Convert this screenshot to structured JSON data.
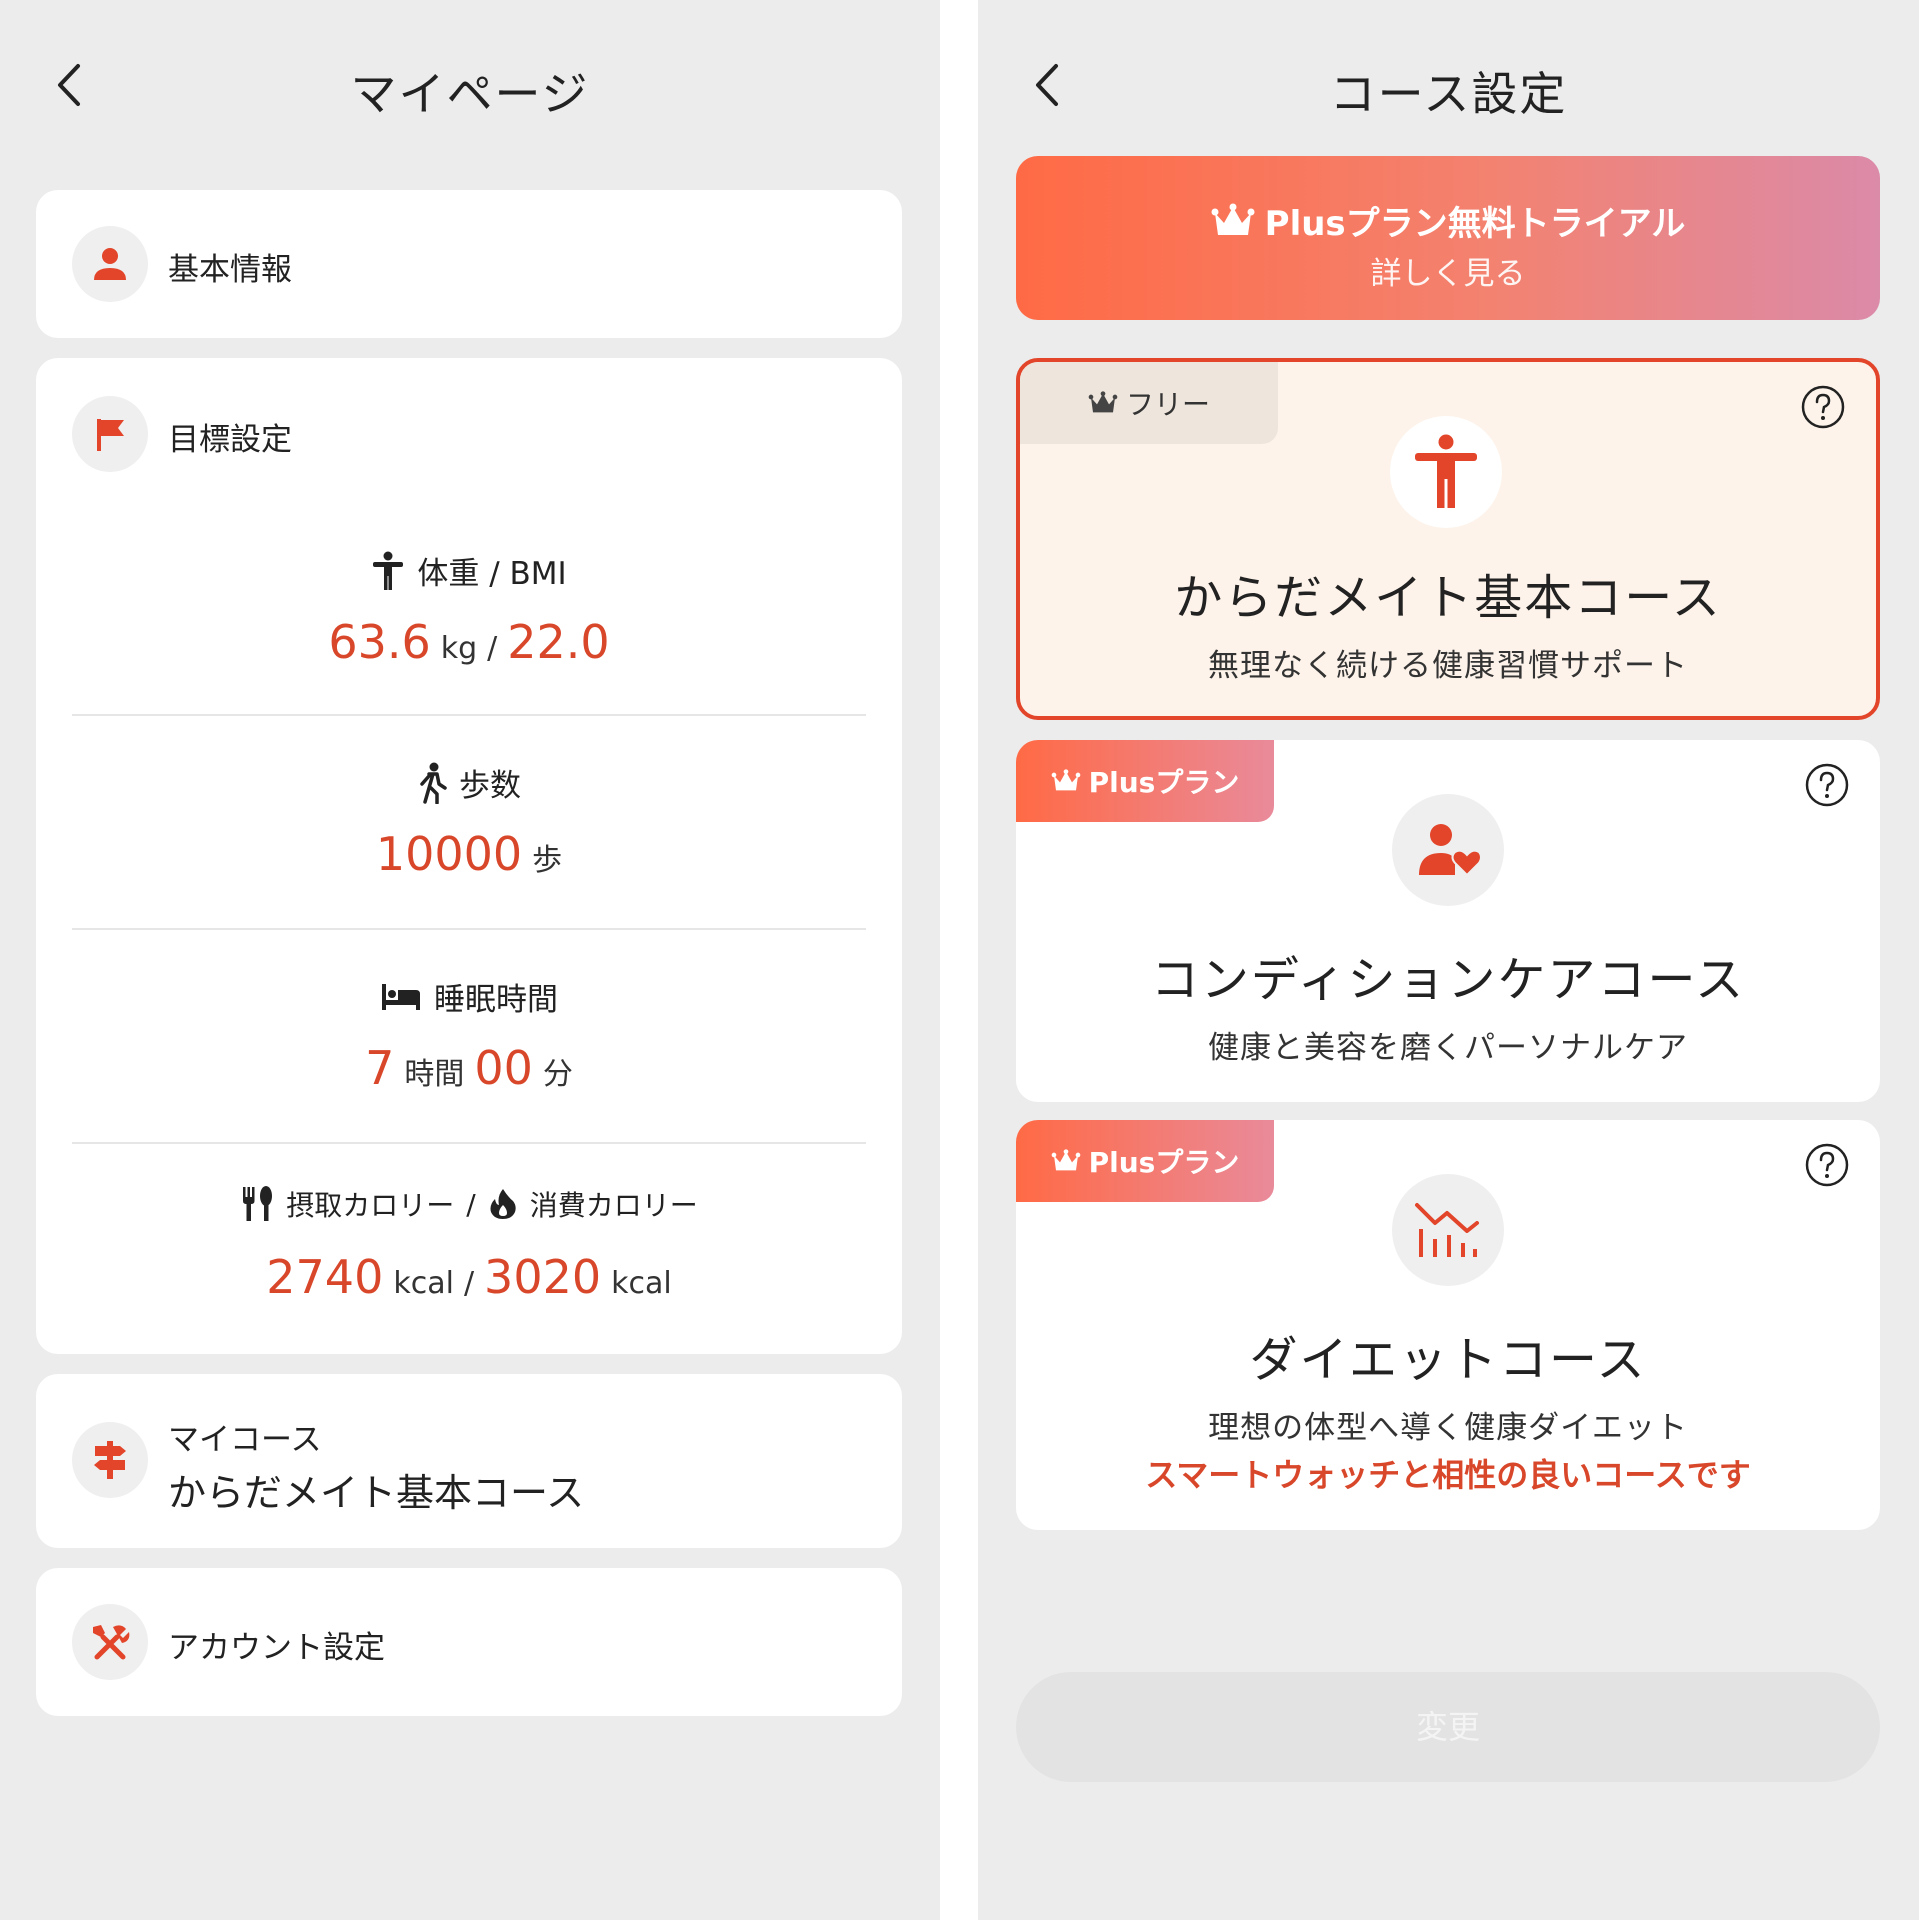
{
  "mypage": {
    "title": "マイページ",
    "basic_info": "基本情報",
    "goal": {
      "label": "目標設定",
      "weight_title": "体重 / BMI",
      "weight_value": "63.6",
      "weight_unit": "kg",
      "sep": "/",
      "bmi_value": "22.0",
      "steps_title": "歩数",
      "steps_value": "10000",
      "steps_unit": "歩",
      "sleep_title": "睡眠時間",
      "sleep_hours": "7",
      "sleep_hours_unit": "時間",
      "sleep_minutes": "00",
      "sleep_minutes_unit": "分",
      "intake_title": "摂取カロリー",
      "burn_title": "消費カロリー",
      "intake_value": "2740",
      "burn_value": "3020",
      "kcal": "kcal"
    },
    "my_course_label": "マイコース",
    "my_course_value": "からだメイト基本コース",
    "account": "アカウント設定"
  },
  "course_settings": {
    "title": "コース設定",
    "banner_title": "Plusプラン無料トライアル",
    "banner_sub": "詳しく見る",
    "courses": [
      {
        "tag": "フリー",
        "name": "からだメイト基本コース",
        "desc": "無理なく続ける健康習慣サポート"
      },
      {
        "tag": "Plusプラン",
        "name": "コンディションケアコース",
        "desc": "健康と美容を磨くパーソナルケア"
      },
      {
        "tag": "Plusプラン",
        "name": "ダイエットコース",
        "desc": "理想の体型へ導く健康ダイエット",
        "note": "スマートウォッチと相性の良いコースです"
      }
    ],
    "change_button": "変更"
  },
  "colors": {
    "accent": "#d9472b",
    "background": "#ececec"
  }
}
